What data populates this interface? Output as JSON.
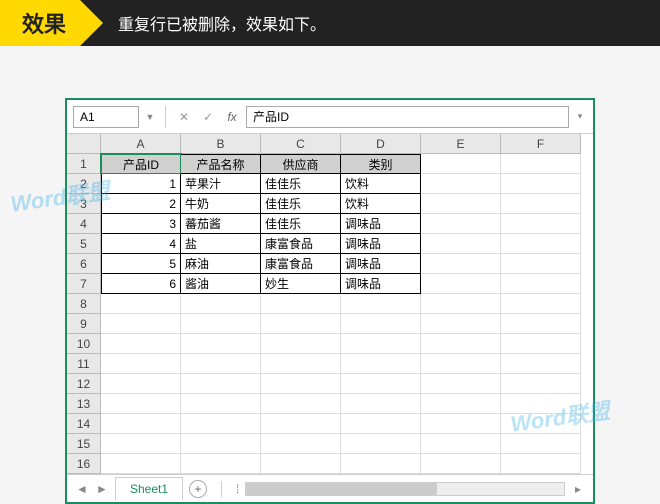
{
  "banner": {
    "label": "效果",
    "text": "重复行已被删除，效果如下。"
  },
  "cellRef": "A1",
  "formulaValue": "产品ID",
  "columns": [
    "A",
    "B",
    "C",
    "D",
    "E",
    "F"
  ],
  "rowCount": 16,
  "headers": [
    "产品ID",
    "产品名称",
    "供应商",
    "类别"
  ],
  "rows": [
    [
      "1",
      "苹果汁",
      "佳佳乐",
      "饮料"
    ],
    [
      "2",
      "牛奶",
      "佳佳乐",
      "饮料"
    ],
    [
      "3",
      "蕃茄酱",
      "佳佳乐",
      "调味品"
    ],
    [
      "4",
      "盐",
      "康富食品",
      "调味品"
    ],
    [
      "5",
      "麻油",
      "康富食品",
      "调味品"
    ],
    [
      "6",
      "酱油",
      "妙生",
      "调味品"
    ]
  ],
  "sheetTab": "Sheet1",
  "watermark": "Word联盟"
}
